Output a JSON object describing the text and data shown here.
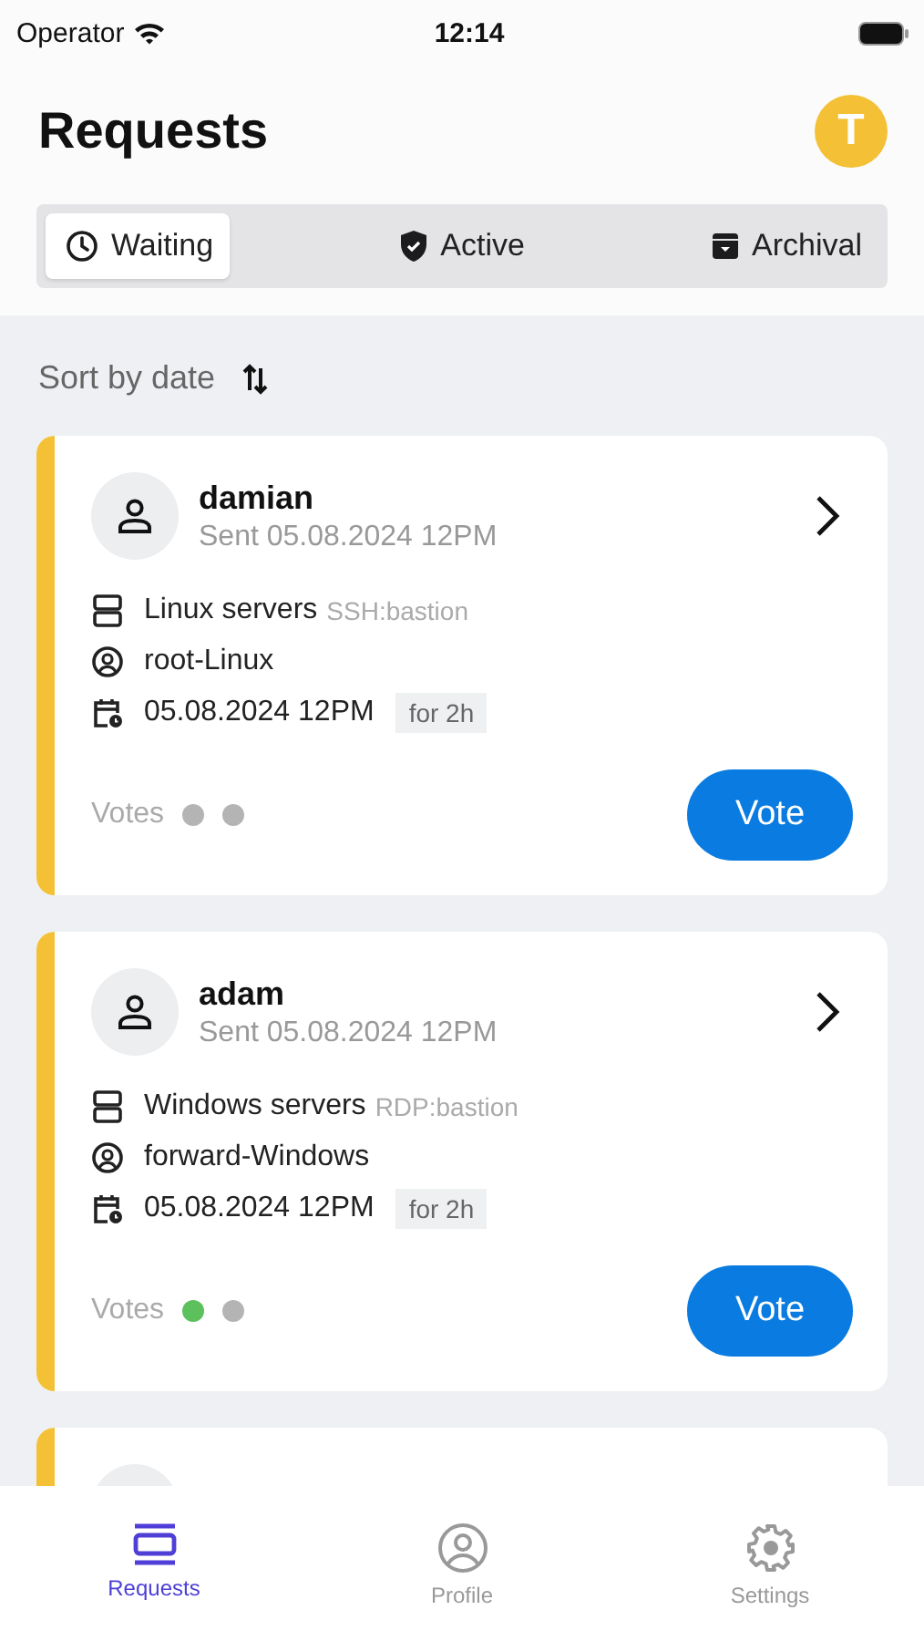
{
  "status_bar": {
    "carrier": "Operator",
    "time": "12:14"
  },
  "header": {
    "title": "Requests",
    "avatar_initial": "T"
  },
  "tabs": [
    {
      "label": "Waiting",
      "selected": true
    },
    {
      "label": "Active",
      "selected": false
    },
    {
      "label": "Archival",
      "selected": false
    }
  ],
  "sort": {
    "label": "Sort by date"
  },
  "requests": [
    {
      "user": "damian",
      "sent": "Sent 05.08.2024 12PM",
      "target": "Linux servers",
      "protocol": "SSH:bastion",
      "account": "root-Linux",
      "date": "05.08.2024 12PM",
      "duration": "for 2h",
      "votes_label": "Votes",
      "votes": [
        {
          "color": "#b4b4b4"
        },
        {
          "color": "#b4b4b4"
        }
      ],
      "action": "Vote"
    },
    {
      "user": "adam",
      "sent": "Sent 05.08.2024 12PM",
      "target": "Windows servers",
      "protocol": "RDP:bastion",
      "account": "forward-Windows",
      "date": "05.08.2024 12PM",
      "duration": "for 2h",
      "votes_label": "Votes",
      "votes": [
        {
          "color": "#5cc05c"
        },
        {
          "color": "#b4b4b4"
        }
      ],
      "action": "Vote"
    }
  ],
  "bottom_nav": [
    {
      "label": "Requests",
      "selected": true
    },
    {
      "label": "Profile",
      "selected": false
    },
    {
      "label": "Settings",
      "selected": false
    }
  ]
}
